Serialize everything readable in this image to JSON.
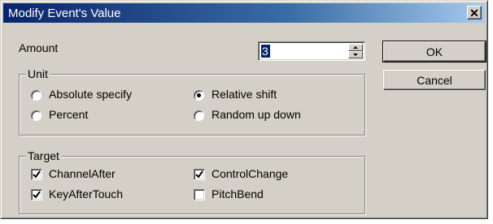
{
  "window": {
    "title": "Modify Event's Value",
    "close_glyph": "✕",
    "close_icon": "close-icon"
  },
  "amount": {
    "label": "Amount",
    "value": "3"
  },
  "buttons": {
    "ok": "OK",
    "cancel": "Cancel"
  },
  "unit": {
    "legend": "Unit",
    "options": [
      {
        "label": "Absolute specify",
        "checked": false
      },
      {
        "label": "Relative shift",
        "checked": true
      },
      {
        "label": "Percent",
        "checked": false
      },
      {
        "label": "Random up down",
        "checked": false
      }
    ]
  },
  "target": {
    "legend": "Target",
    "options": [
      {
        "label": "ChannelAfter",
        "checked": true
      },
      {
        "label": "ControlChange",
        "checked": true
      },
      {
        "label": "KeyAfterTouch",
        "checked": true
      },
      {
        "label": "PitchBend",
        "checked": false
      }
    ]
  }
}
